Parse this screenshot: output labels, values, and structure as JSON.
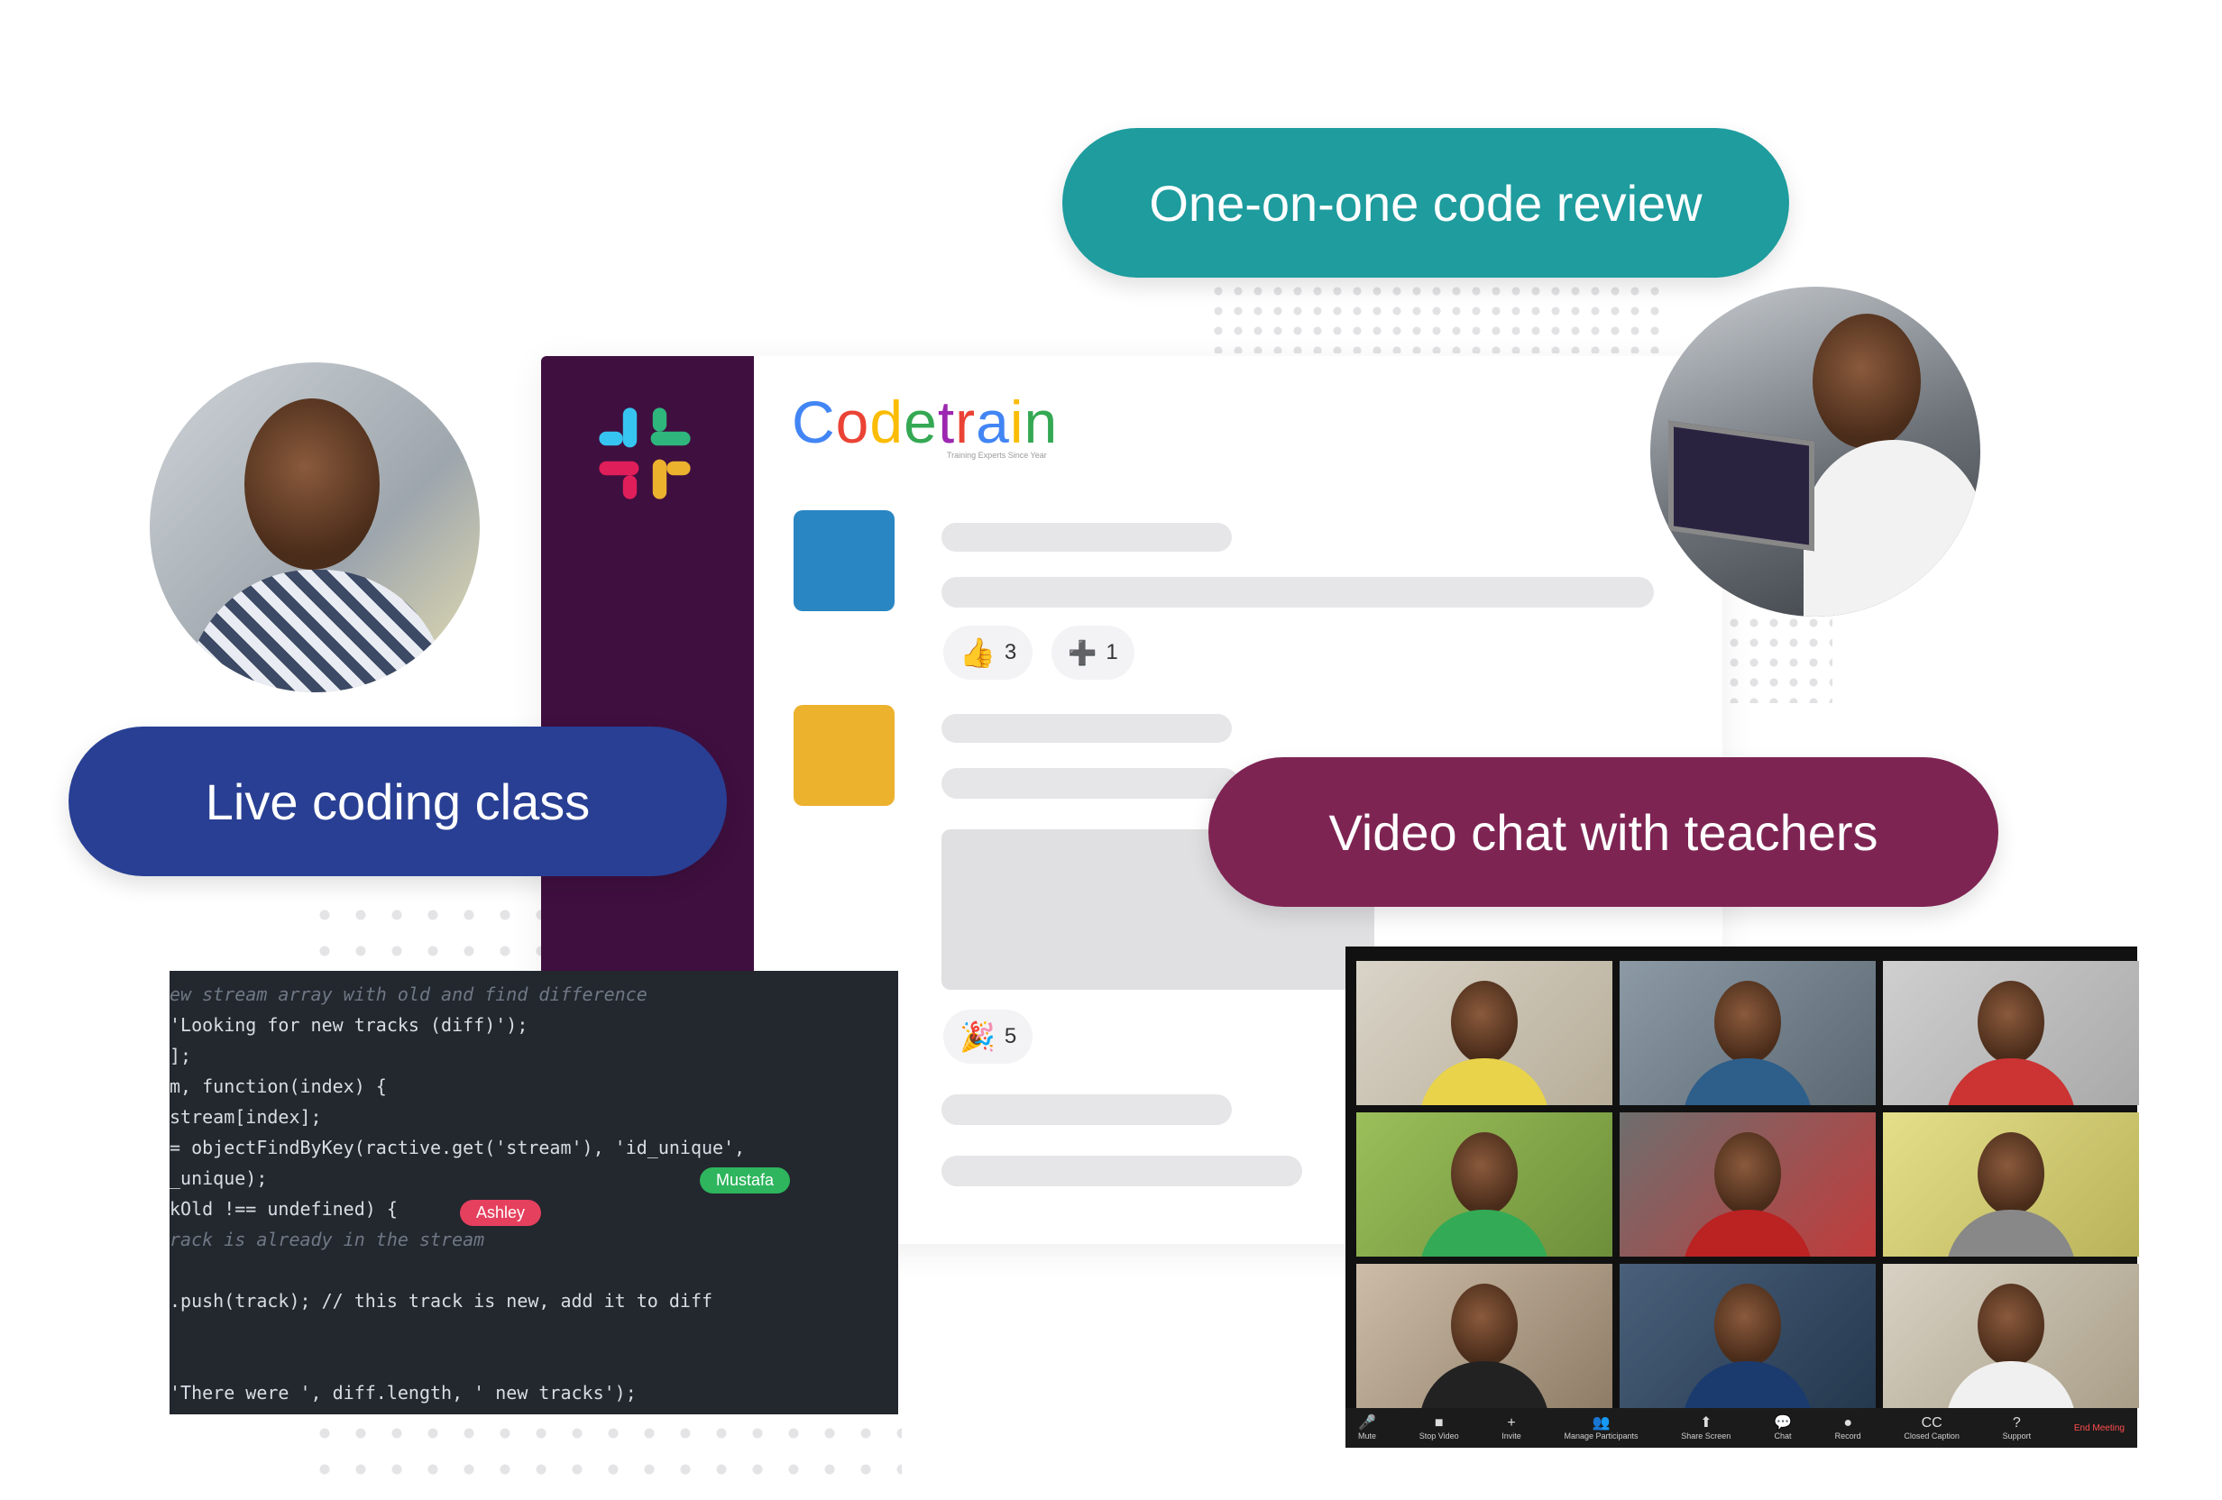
{
  "pills": {
    "review": "One-on-one code review",
    "live": "Live coding class",
    "video": "Video chat with teachers"
  },
  "brand": {
    "name": "Codetrain",
    "letters": [
      "C",
      "o",
      "d",
      "e",
      "t",
      "r",
      "a",
      "i",
      "n"
    ],
    "letter_colors": [
      "#4285f4",
      "#ea4335",
      "#fbbc05",
      "#34a853",
      "#9c27b0",
      "#ea4335",
      "#4285f4",
      "#fbbc05",
      "#34a853"
    ],
    "tagline": "Training Experts Since Year"
  },
  "feed": {
    "avatar_colors": [
      "#2a86c2",
      "#ecb22e"
    ],
    "reactions": [
      {
        "icon": "👍",
        "count": "3"
      },
      {
        "icon": "➕",
        "count": "1"
      },
      {
        "icon": "🎉",
        "count": "5"
      }
    ]
  },
  "slack_colors": [
    "#36c5f0",
    "#2eb67d",
    "#ecb22e",
    "#e01e5a"
  ],
  "code": {
    "lines": [
      "ew stream array with old and find difference",
      "'Looking for new tracks (diff)');",
      "];",
      "m, function(index) {",
      "stream[index];",
      "= objectFindByKey(ractive.get('stream'), 'id_unique',",
      "_unique);",
      "kOld !== undefined) {",
      "rack is already in the stream",
      "",
      ".push(track); // this track is new, add it to diff",
      "",
      "",
      "'There were ', diff.length, ' new tracks');"
    ],
    "cursor_tags": [
      {
        "name": "Ashley",
        "color": "#e5405e"
      },
      {
        "name": "Mustafa",
        "color": "#2eb55d"
      }
    ]
  },
  "video_toolbar": {
    "items": [
      "Mute",
      "Stop Video",
      "Invite",
      "Manage Participants",
      "Share Screen",
      "Chat",
      "Record",
      "Closed Caption",
      "Support"
    ],
    "end": "End Meeting"
  }
}
